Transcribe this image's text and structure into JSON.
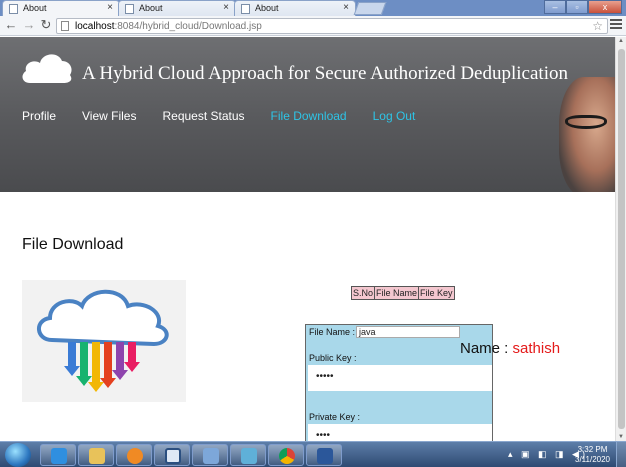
{
  "browser": {
    "tabs": [
      {
        "label": "About",
        "active": true
      },
      {
        "label": "About",
        "active": false
      },
      {
        "label": "About",
        "active": false
      }
    ],
    "tab_close_glyph": "×",
    "url_host": "localhost",
    "url_path": ":8084/hybrid_cloud/Download.jsp",
    "icons": [
      "back-arrow-icon",
      "forward-arrow-icon",
      "reload-icon",
      "page-icon",
      "bookmark-star-icon",
      "menu-icon"
    ]
  },
  "site": {
    "title": "A Hybrid Cloud Approach for Secure Authorized Deduplication",
    "nav": [
      {
        "label": "Profile",
        "active": false
      },
      {
        "label": "View Files",
        "active": false
      },
      {
        "label": "Request Status",
        "active": false
      },
      {
        "label": "File Download",
        "active": true
      },
      {
        "label": "Log Out",
        "active": false
      }
    ],
    "accent_color": "#2ec4e6",
    "hero_color": "#5c5d60"
  },
  "main": {
    "section_title": "File Download",
    "table_headers": [
      "S.No",
      "File Name",
      "File Key"
    ],
    "form": {
      "file_name_label": "File Name :",
      "file_name_value": "java",
      "public_key_label": "Public Key :",
      "public_key_value": "•••••",
      "private_key_label": "Private Key :",
      "private_key_value": "••••"
    },
    "name_label": "Name :",
    "name_value": "sathish",
    "name_color": "#e41b1b"
  },
  "taskbar": {
    "time": "3:32 PM",
    "date": "3/11/2020",
    "pinned": [
      "internet-explorer-icon",
      "explorer-folder-icon",
      "media-icon",
      "virtualbox-icon",
      "netbeans-icon",
      "app-icon",
      "chrome-icon",
      "word-icon"
    ]
  }
}
